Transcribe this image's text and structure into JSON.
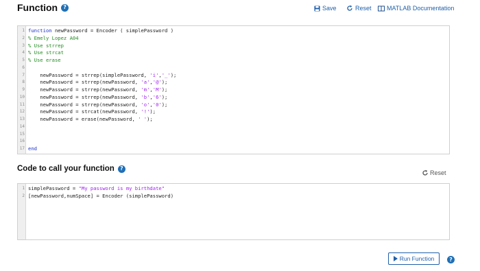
{
  "header": {
    "title": "Function",
    "save_label": "Save",
    "reset_label": "Reset",
    "doc_label": "MATLAB Documentation"
  },
  "function_editor": {
    "lines": [
      {
        "num": "1",
        "segments": [
          {
            "t": "function",
            "c": "kw"
          },
          {
            "t": " newPassword = Encoder ( simplePassword )",
            "c": ""
          }
        ]
      },
      {
        "num": "2",
        "segments": [
          {
            "t": "% Emely Lopez A04",
            "c": "cm"
          }
        ]
      },
      {
        "num": "3",
        "segments": [
          {
            "t": "% Use strrep",
            "c": "cm"
          }
        ]
      },
      {
        "num": "4",
        "segments": [
          {
            "t": "% Use strcat",
            "c": "cm"
          }
        ]
      },
      {
        "num": "5",
        "segments": [
          {
            "t": "% Use erase",
            "c": "cm"
          }
        ]
      },
      {
        "num": "6",
        "segments": []
      },
      {
        "num": "7",
        "segments": [
          {
            "t": "    newPassword = strrep(simplePassword, ",
            "c": ""
          },
          {
            "t": "'i'",
            "c": "st"
          },
          {
            "t": ",",
            "c": ""
          },
          {
            "t": "'_'",
            "c": "st"
          },
          {
            "t": ");",
            "c": ""
          }
        ]
      },
      {
        "num": "8",
        "segments": [
          {
            "t": "    newPassword = strrep(newPassword, ",
            "c": ""
          },
          {
            "t": "'a'",
            "c": "st"
          },
          {
            "t": ",",
            "c": ""
          },
          {
            "t": "'@'",
            "c": "st"
          },
          {
            "t": ");",
            "c": ""
          }
        ]
      },
      {
        "num": "9",
        "segments": [
          {
            "t": "    newPassword = strrep(newPassword, ",
            "c": ""
          },
          {
            "t": "'m'",
            "c": "st"
          },
          {
            "t": ",",
            "c": ""
          },
          {
            "t": "'M'",
            "c": "st"
          },
          {
            "t": ");",
            "c": ""
          }
        ]
      },
      {
        "num": "10",
        "segments": [
          {
            "t": "    newPassword = strrep(newPassword, ",
            "c": ""
          },
          {
            "t": "'b'",
            "c": "st"
          },
          {
            "t": ",",
            "c": ""
          },
          {
            "t": "'6'",
            "c": "st"
          },
          {
            "t": ");",
            "c": ""
          }
        ]
      },
      {
        "num": "11",
        "segments": [
          {
            "t": "    newPassword = strrep(newPassword, ",
            "c": ""
          },
          {
            "t": "'o'",
            "c": "st"
          },
          {
            "t": ",",
            "c": ""
          },
          {
            "t": "'0'",
            "c": "st"
          },
          {
            "t": ");",
            "c": ""
          }
        ]
      },
      {
        "num": "12",
        "segments": [
          {
            "t": "    newPassword = strcat(newPassword, ",
            "c": ""
          },
          {
            "t": "'!'",
            "c": "st"
          },
          {
            "t": ");",
            "c": ""
          }
        ]
      },
      {
        "num": "13",
        "segments": [
          {
            "t": "    newPassword = erase(newPassword, ",
            "c": ""
          },
          {
            "t": "' '",
            "c": "st"
          },
          {
            "t": ");",
            "c": ""
          }
        ]
      },
      {
        "num": "14",
        "segments": []
      },
      {
        "num": "15",
        "segments": []
      },
      {
        "num": "16",
        "segments": []
      },
      {
        "num": "17",
        "segments": [
          {
            "t": "end",
            "c": "kw"
          }
        ]
      }
    ]
  },
  "call_section": {
    "title": "Code to call your function",
    "reset_label": "Reset"
  },
  "call_editor": {
    "lines": [
      {
        "num": "1",
        "segments": [
          {
            "t": "simplePassword = ",
            "c": ""
          },
          {
            "t": "\"My password is my birthdate\"",
            "c": "st"
          }
        ]
      },
      {
        "num": "2",
        "segments": [
          {
            "t": "[newPassword,numSpace] = Encoder (simplePassword)",
            "c": ""
          }
        ]
      }
    ]
  },
  "run": {
    "label": "Run Function"
  },
  "colors": {
    "accent": "#1f5fa8",
    "keyword": "#1b31c9",
    "comment": "#228b22",
    "string": "#a020f0"
  }
}
